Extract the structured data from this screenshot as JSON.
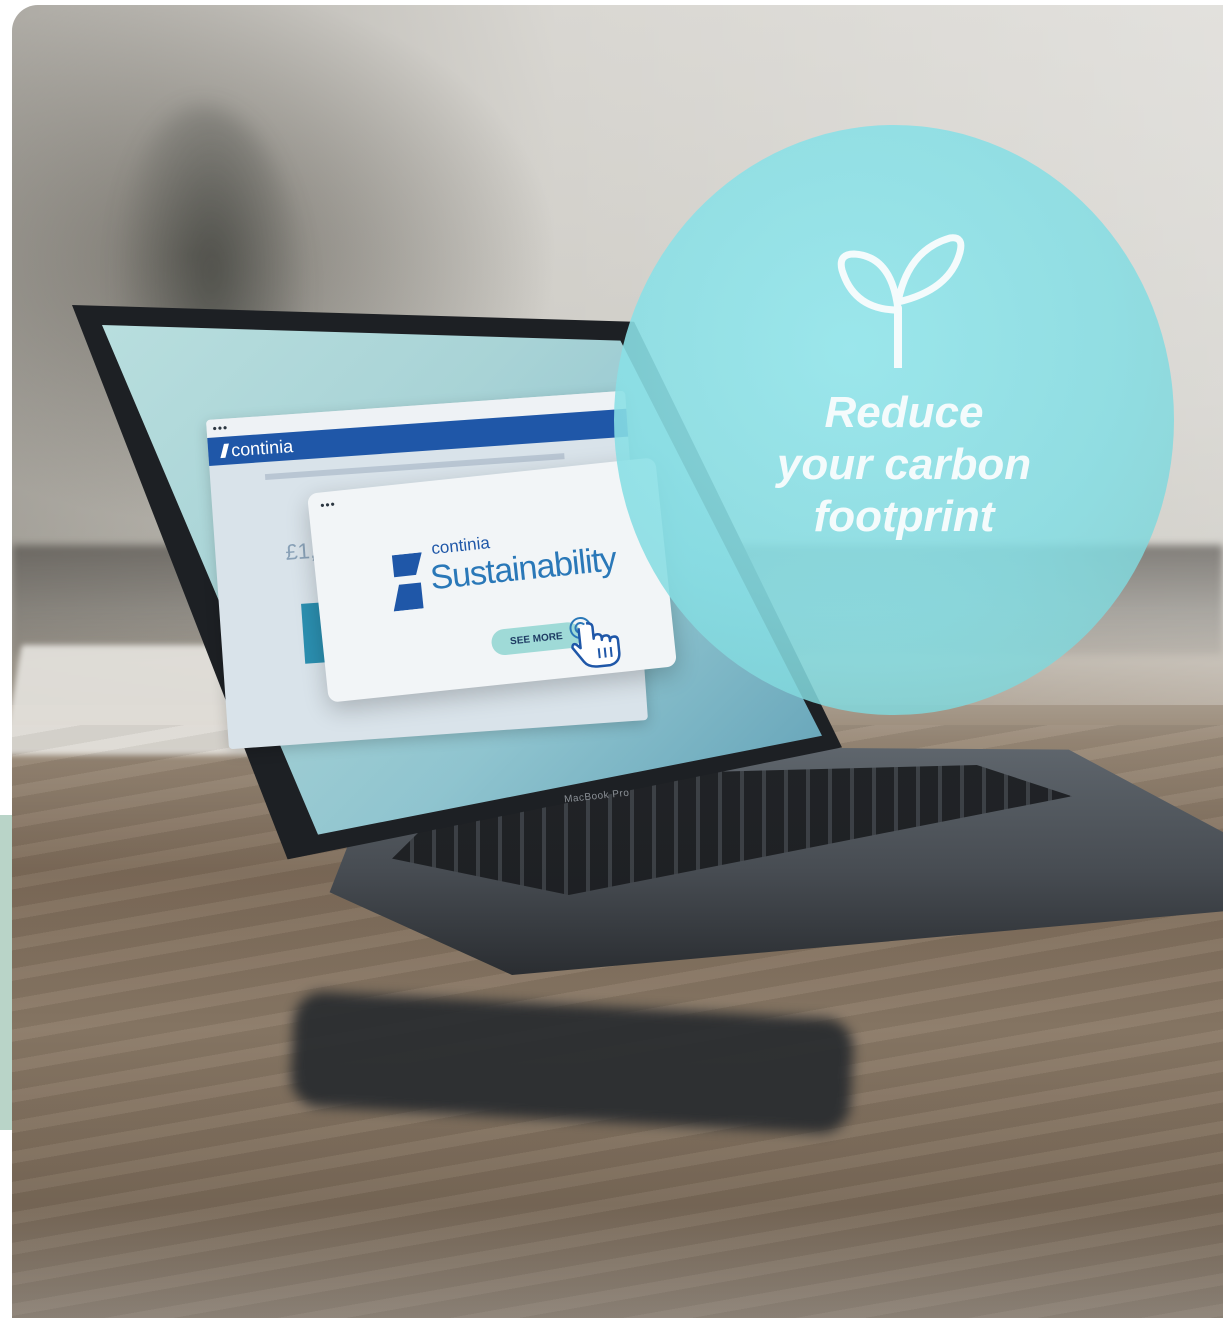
{
  "hero": {
    "headline_lines": [
      "Reduce",
      "your carbon",
      "footprint"
    ]
  },
  "screen": {
    "app_logo": "continia",
    "stat_value": "£1,23",
    "popup": {
      "brand": "continia",
      "title": "Sustainability",
      "button_label": "SEE MORE"
    }
  },
  "laptop": {
    "model_label": "MacBook Pro"
  },
  "icons": {
    "badge_icon": "sprout-icon",
    "cursor_icon": "hand-pointer-icon",
    "logo_icon": "continia-logo-icon"
  },
  "colors": {
    "badge": "#8fe0e6",
    "brand_blue": "#1f57a8",
    "button": "#9fdad7",
    "side_bar": "#b9d4c8"
  }
}
